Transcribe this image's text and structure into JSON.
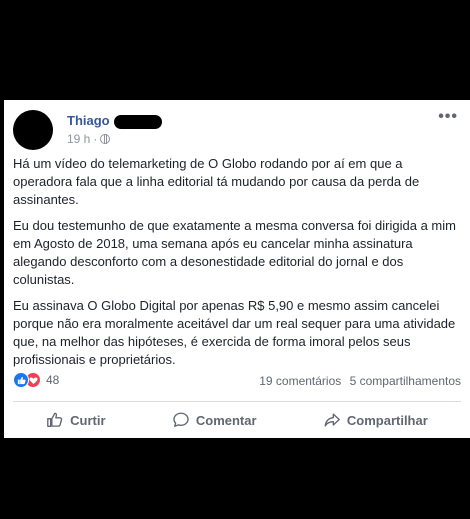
{
  "post": {
    "author": "Thiago",
    "time": "19 h",
    "time_separator": "·",
    "more_menu": "•••",
    "paragraphs": [
      "Há um vídeo do telemarketing de O Globo rodando por aí em que a operadora fala que a linha editorial tá mudando por causa da perda de assinantes.",
      "Eu dou testemunho de que exatamente a mesma conversa foi dirigida a mim em Agosto de 2018, uma semana após eu cancelar minha assinatura alegando desconforto com a desonestidade editorial do jornal e dos colunistas.",
      "Eu assinava O Globo Digital por apenas R$ 5,90 e mesmo assim cancelei porque não era moralmente aceitável dar um real sequer para uma atividade que, na melhor das hipóteses, é exercida de forma imoral pelos seus profissionais e proprietários."
    ],
    "reaction_count": "48",
    "comments": "19 comentários",
    "shares": "5 compartilhamentos",
    "actions": {
      "like": "Curtir",
      "comment": "Comentar",
      "share": "Compartilhar"
    },
    "icons": {
      "like_reaction": "thumbs-up-icon",
      "love_reaction": "heart-icon",
      "privacy": "globe-icon"
    },
    "colors": {
      "author": "#365899",
      "like": "#1877f2",
      "love": "#f33e58"
    }
  }
}
